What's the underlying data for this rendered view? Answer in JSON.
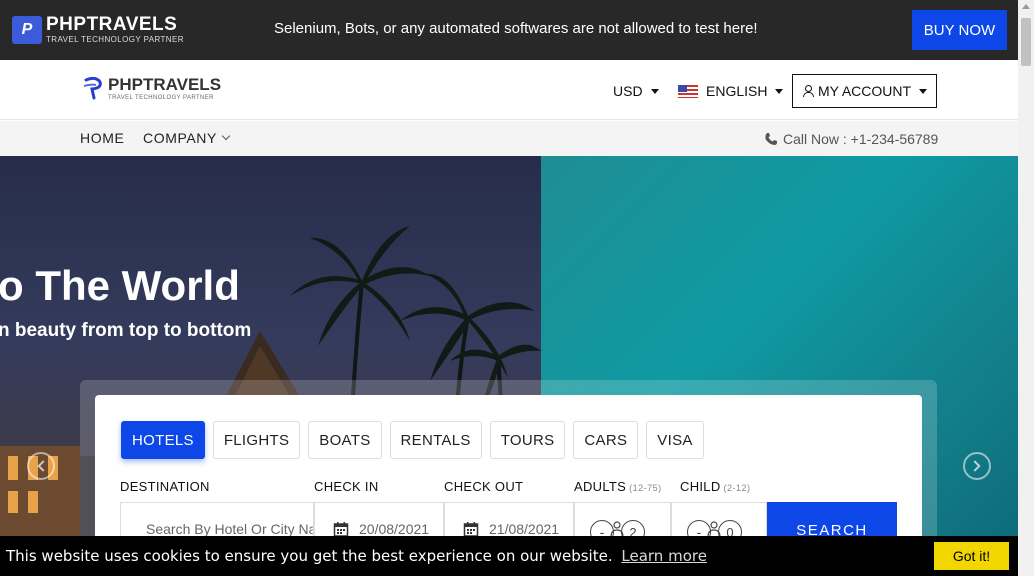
{
  "topbar": {
    "logo_mark": "P",
    "logo_name": "PHPTRAVELS",
    "logo_tagline": "TRAVEL TECHNOLOGY PARTNER",
    "notice": "Selenium, Bots, or any automated softwares are not allowed to test here!",
    "buy_label": "BUY NOW"
  },
  "header": {
    "logo_name": "PHPTRAVELS",
    "logo_tagline": "TRAVEL TECHNOLOGY PARTNER",
    "currency": "USD",
    "language": "ENGLISH",
    "account": "MY ACCOUNT"
  },
  "nav": {
    "home": "HOME",
    "company": "COMPANY",
    "call": "Call Now : +1-234-56789"
  },
  "hero": {
    "title": "o The World",
    "subtitle": "n beauty from top to bottom"
  },
  "search": {
    "tabs": [
      {
        "label": "HOTELS",
        "active": true
      },
      {
        "label": "FLIGHTS",
        "active": false
      },
      {
        "label": "BOATS",
        "active": false
      },
      {
        "label": "RENTALS",
        "active": false
      },
      {
        "label": "TOURS",
        "active": false
      },
      {
        "label": "CARS",
        "active": false
      },
      {
        "label": "VISA",
        "active": false
      }
    ],
    "destination_label": "DESTINATION",
    "destination_placeholder": "Search By Hotel Or City Name",
    "checkin_label": "CHECK IN",
    "checkin_value": "20/08/2021",
    "checkout_label": "CHECK OUT",
    "checkout_value": "21/08/2021",
    "adults_label": "ADULTS",
    "adults_range": "(12-75)",
    "adults_value": "2",
    "child_label": "CHILD",
    "child_range": "(2-12)",
    "child_value": "0",
    "stepper_minus": "-",
    "search_label": "SEARCH"
  },
  "cookie": {
    "message": "This website uses cookies to ensure you get the best experience on our website.",
    "link": "Learn more",
    "button": "Got it!"
  },
  "colors": {
    "primary": "#0d47e8",
    "topbar_bg": "#282828",
    "cookie_bg": "#000000",
    "cookie_button": "#f1d600"
  }
}
